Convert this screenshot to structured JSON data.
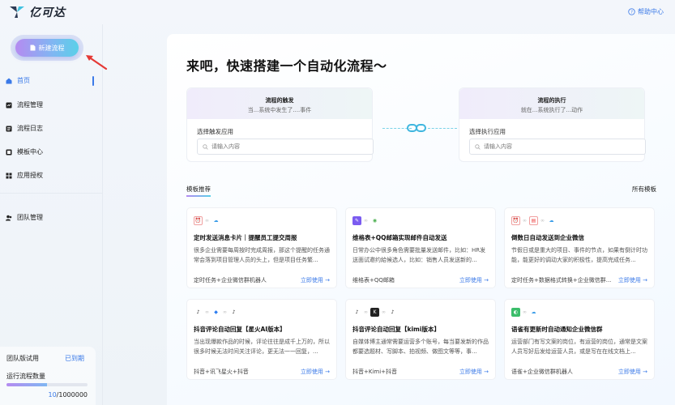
{
  "app": {
    "name": "亿可达"
  },
  "header": {
    "help_label": "帮助中心"
  },
  "sidebar": {
    "new_button": "新建流程",
    "items": [
      {
        "label": "首页",
        "icon": "home-icon"
      },
      {
        "label": "流程管理",
        "icon": "flow-icon"
      },
      {
        "label": "流程日志",
        "icon": "log-icon"
      },
      {
        "label": "模板中心",
        "icon": "template-icon"
      },
      {
        "label": "应用授权",
        "icon": "apps-icon"
      },
      {
        "label": "团队管理",
        "icon": "team-icon"
      }
    ],
    "trial": {
      "title": "团队版试用",
      "expired": "已到期",
      "runs_label": "运行流程数量",
      "used": "10",
      "total": "/1000000",
      "progress_fraction": 0.5
    }
  },
  "main": {
    "headline": "来吧，快速搭建一个自动化流程～",
    "trigger": {
      "title": "流程的触发",
      "subtitle": "当...系统中发生了....事件",
      "label": "选择触发应用",
      "placeholder": "请输入内容"
    },
    "action": {
      "title": "流程的执行",
      "subtitle": "就在...系统执行了...动作",
      "label": "选择执行应用",
      "placeholder": "请输入内容"
    },
    "tab_active": "模板推荐",
    "tab_all": "所有模板",
    "use_label": "立即使用 →",
    "cards": [
      {
        "title": "定时发送消息卡片｜提醒员工提交周报",
        "desc": "很多企业需要每周按时完成周报，那这个提醒的任务通常会落到项目管理人员的头上，但是项目任务繁...",
        "foot": "定时任务+企业微信群机器人",
        "icons": [
          {
            "bg": "#fff",
            "fg": "#e44",
            "glyph": "⏰",
            "border": "#f0a0a0"
          },
          {
            "bg": "#fff",
            "fg": "#3b9de8",
            "glyph": "☁",
            "border": ""
          }
        ]
      },
      {
        "title": "维格表+QQ邮箱实现邮件自动发送",
        "desc": "日常办公中很多角色需要批量发送邮件，比如：HR发送面试邀约給候选人，比如：销售人员发送新的...",
        "foot": "维格表+QQ邮箱",
        "icons": [
          {
            "bg": "#7b5cf0",
            "fg": "#fff",
            "glyph": "✎",
            "border": ""
          },
          {
            "bg": "#fff",
            "fg": "#4caf50",
            "glyph": "◉",
            "border": ""
          }
        ]
      },
      {
        "title": "倒数日自动发送到企业微信",
        "desc": "节假日或是重大的项目、事件的节点，如果有倒计时功能，能更好的调动大家的积极性，提高完成任务...",
        "foot": "定时任务+数据格式转换+企业微信群...",
        "icons": [
          {
            "bg": "#fff",
            "fg": "#e44",
            "glyph": "⏰",
            "border": "#f0a0a0"
          },
          {
            "bg": "#fff",
            "fg": "#e44",
            "glyph": "▤",
            "border": "#f0a0a0"
          },
          {
            "bg": "#fff",
            "fg": "#3b9de8",
            "glyph": "☁",
            "border": ""
          }
        ]
      },
      {
        "title": "抖音评论自动回复【星火AI版本】",
        "desc": "当出现爆款作品的时候，评论往往是成千上万的，所以很多时候无法时间关注评论，更无法一一回复，...",
        "foot": "抖音+讯飞星火+抖音",
        "icons": [
          {
            "bg": "#fff",
            "fg": "#111",
            "glyph": "♪",
            "border": ""
          },
          {
            "bg": "#fff",
            "fg": "#2a7cf0",
            "glyph": "◆",
            "border": ""
          },
          {
            "bg": "#fff",
            "fg": "#111",
            "glyph": "♪",
            "border": ""
          }
        ]
      },
      {
        "title": "抖音评论自动回复【kimi版本】",
        "desc": "自媒体博主通常需要运营多个账号，每当要发新的作品都要选题材、写脚本、拍视频、做图文等等，事...",
        "foot": "抖音+Kimi+抖音",
        "icons": [
          {
            "bg": "#fff",
            "fg": "#111",
            "glyph": "♪",
            "border": ""
          },
          {
            "bg": "#222",
            "fg": "#fff",
            "glyph": "K",
            "border": ""
          },
          {
            "bg": "#fff",
            "fg": "#111",
            "glyph": "♪",
            "border": ""
          }
        ]
      },
      {
        "title": "语雀有更新时自动通知企业微信群",
        "desc": "运营部门有写文案的岗位，有运营的岗位，通常是文案人员写好后发给运营人员，或是写在在线文档上...",
        "foot": "语雀+企业微信群机器人",
        "icons": [
          {
            "bg": "#3bbd6a",
            "fg": "#fff",
            "glyph": "◐",
            "border": ""
          },
          {
            "bg": "#fff",
            "fg": "#3b9de8",
            "glyph": "☁",
            "border": ""
          }
        ]
      }
    ]
  },
  "colors": {
    "accent": "#3b7ae8",
    "annotation": "#e53935"
  }
}
